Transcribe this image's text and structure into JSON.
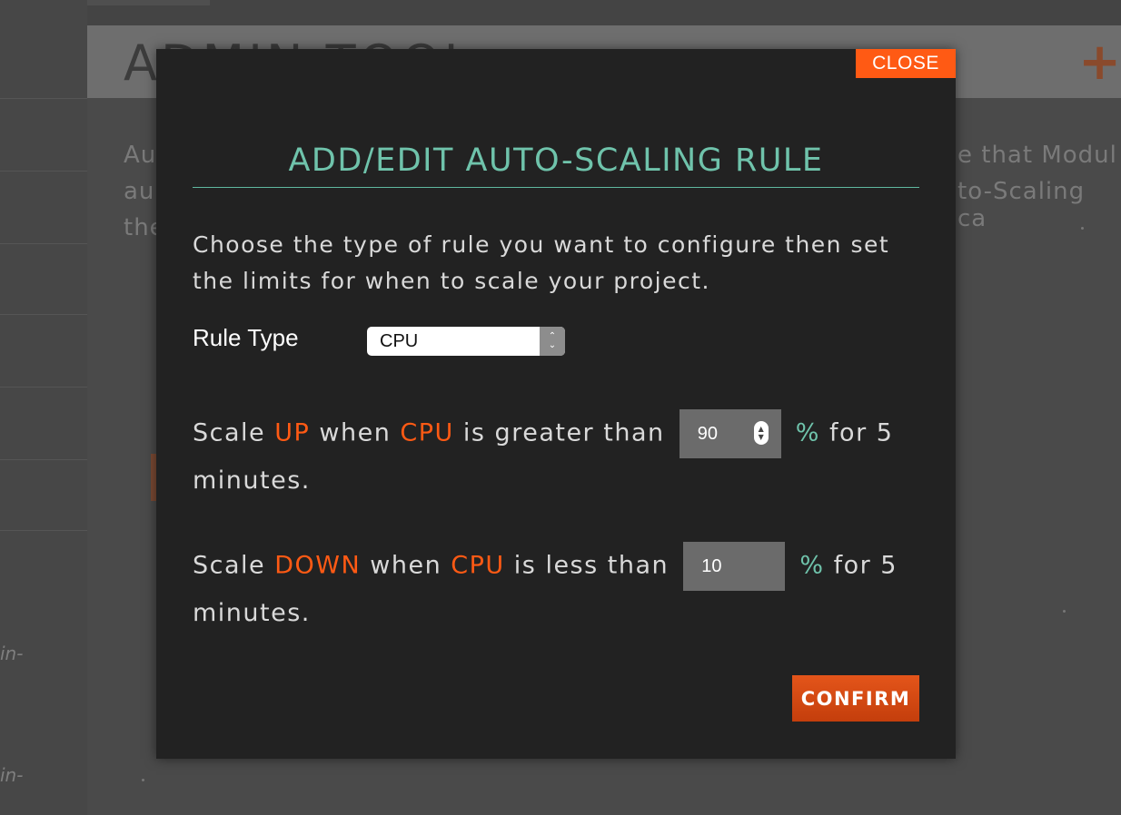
{
  "background": {
    "page_title": "ADMIN TOOL",
    "text_lines": [
      "Au",
      "au",
      "the"
    ],
    "right_fragments": [
      "e that Modul",
      "to-Scaling ca"
    ],
    "side_labels": [
      "in-",
      "in-"
    ]
  },
  "modal": {
    "close_label": "CLOSE",
    "title": "ADD/EDIT AUTO-SCALING RULE",
    "intro": "Choose the type of rule you want to configure then set the limits for when to scale your project.",
    "rule_type": {
      "label": "Rule Type",
      "selected": "CPU"
    },
    "scale_up": {
      "prefix": "Scale",
      "direction": "UP",
      "when": "when",
      "metric": "CPU",
      "comparison": "is greater than",
      "value": "90",
      "unit": "%",
      "suffix": "for 5 minutes."
    },
    "scale_down": {
      "prefix": "Scale",
      "direction": "DOWN",
      "when": "when",
      "metric": "CPU",
      "comparison": "is less than",
      "value": "10",
      "unit": "%",
      "suffix": "for 5 minutes."
    },
    "confirm_label": "CONFIRM"
  },
  "colors": {
    "accent_orange": "#ff5a14",
    "accent_teal": "#6fc3ab",
    "modal_bg": "#222222"
  }
}
